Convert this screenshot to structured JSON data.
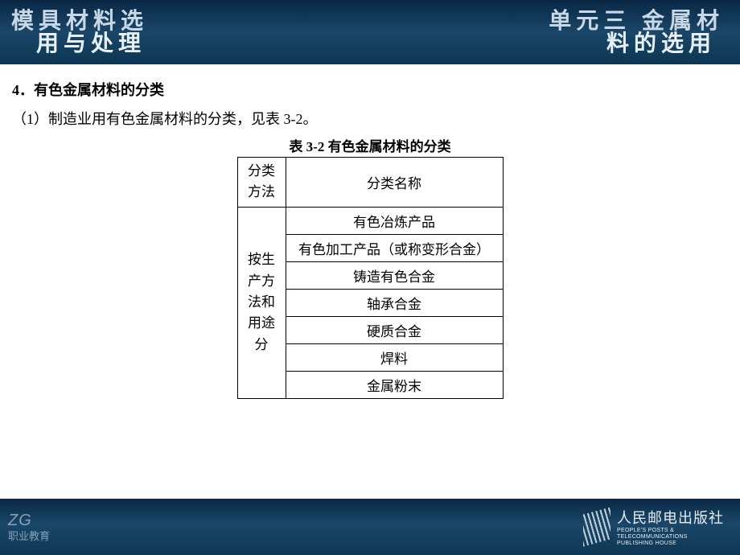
{
  "header": {
    "left_line1": "模具材料选",
    "left_line2": "用与处理",
    "right_line1": "单元三  金属材",
    "right_line2": "料的选用"
  },
  "content": {
    "heading4": "4．有色金属材料的分类",
    "sub1": "（1）制造业用有色金属材料的分类，见表 3-2。",
    "table_caption": "表 3-2  有色金属材料的分类",
    "table": {
      "header_col_method": "分类方法",
      "header_col_name": "分类名称",
      "group_by_prod": "按生产方法和用途分",
      "rows_by_prod": [
        "有色冶炼产品",
        "有色加工产品（或称变形合金）",
        "铸造有色合金",
        "轴承合金",
        "硬质合金",
        "焊料",
        "金属粉末"
      ]
    }
  },
  "footer": {
    "left_top": "ZG",
    "left_bottom": "职业教育",
    "publisher_cn": "人民邮电出版社",
    "publisher_en1": "PEOPLE'S  POSTS  &",
    "publisher_en2": "TELECOMMUNICATIONS",
    "publisher_en3": "PUBLISHING  HOUSE"
  }
}
